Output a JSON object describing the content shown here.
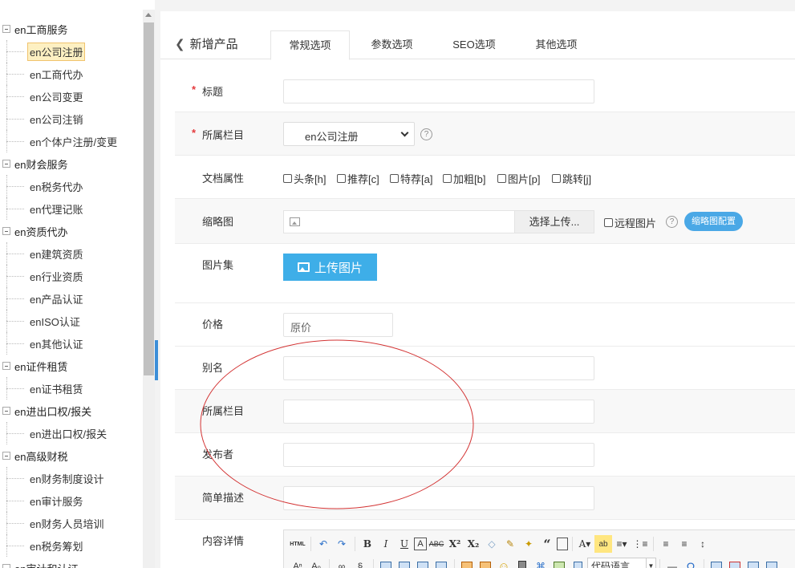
{
  "sidebar": {
    "items": [
      {
        "type": "cat",
        "label": "en工商服务"
      },
      {
        "type": "child",
        "label": "en公司注册",
        "active": true
      },
      {
        "type": "child",
        "label": "en工商代办"
      },
      {
        "type": "child",
        "label": "en公司变更"
      },
      {
        "type": "child",
        "label": "en公司注销"
      },
      {
        "type": "child",
        "label": "en个体户注册/变更"
      },
      {
        "type": "cat",
        "label": "en财会服务"
      },
      {
        "type": "child",
        "label": "en税务代办"
      },
      {
        "type": "child",
        "label": "en代理记账"
      },
      {
        "type": "cat",
        "label": "en资质代办"
      },
      {
        "type": "child",
        "label": "en建筑资质"
      },
      {
        "type": "child",
        "label": "en行业资质"
      },
      {
        "type": "child",
        "label": "en产品认证"
      },
      {
        "type": "child",
        "label": "enISO认证"
      },
      {
        "type": "child",
        "label": "en其他认证"
      },
      {
        "type": "cat",
        "label": "en证件租赁"
      },
      {
        "type": "child",
        "label": "en证书租赁"
      },
      {
        "type": "cat",
        "label": "en进出口权/报关"
      },
      {
        "type": "child",
        "label": "en进出口权/报关"
      },
      {
        "type": "cat",
        "label": "en高级财税"
      },
      {
        "type": "child",
        "label": "en财务制度设计"
      },
      {
        "type": "child",
        "label": "en审计服务"
      },
      {
        "type": "child",
        "label": "en财务人员培训"
      },
      {
        "type": "child",
        "label": "en税务筹划"
      },
      {
        "type": "cat",
        "label": "en审计和认证"
      }
    ]
  },
  "header": {
    "back_label": "新增产品",
    "tabs": [
      "常规选项",
      "参数选项",
      "SEO选项",
      "其他选项"
    ]
  },
  "form": {
    "title_label": "标题",
    "column_label": "所属栏目",
    "column_value": "en公司注册",
    "doc_attr_label": "文档属性",
    "attrs": [
      "头条[h]",
      "推荐[c]",
      "特荐[a]",
      "加粗[b]",
      "图片[p]",
      "跳转[j]"
    ],
    "thumb_label": "缩略图",
    "thumb_button": "选择上传...",
    "remote_label": "远程图片",
    "thumb_config": "缩略图配置",
    "gallery_label": "图片集",
    "upload_label": "上传图片",
    "price_label": "价格",
    "price_placeholder": "原价",
    "alias_label": "别名",
    "column2_label": "所属栏目",
    "publisher_label": "发布者",
    "desc_label": "简单描述",
    "content_label": "内容详情",
    "required_mark": "*",
    "help_glyph": "?"
  },
  "editor": {
    "html_label": "HTML",
    "code_lang": "代码语言"
  },
  "colors": {
    "accent": "#3eaee8",
    "pill": "#4aa8e6",
    "required": "#e4393c",
    "annotation": "#d33333",
    "active_bg": "#fdf0c2"
  }
}
